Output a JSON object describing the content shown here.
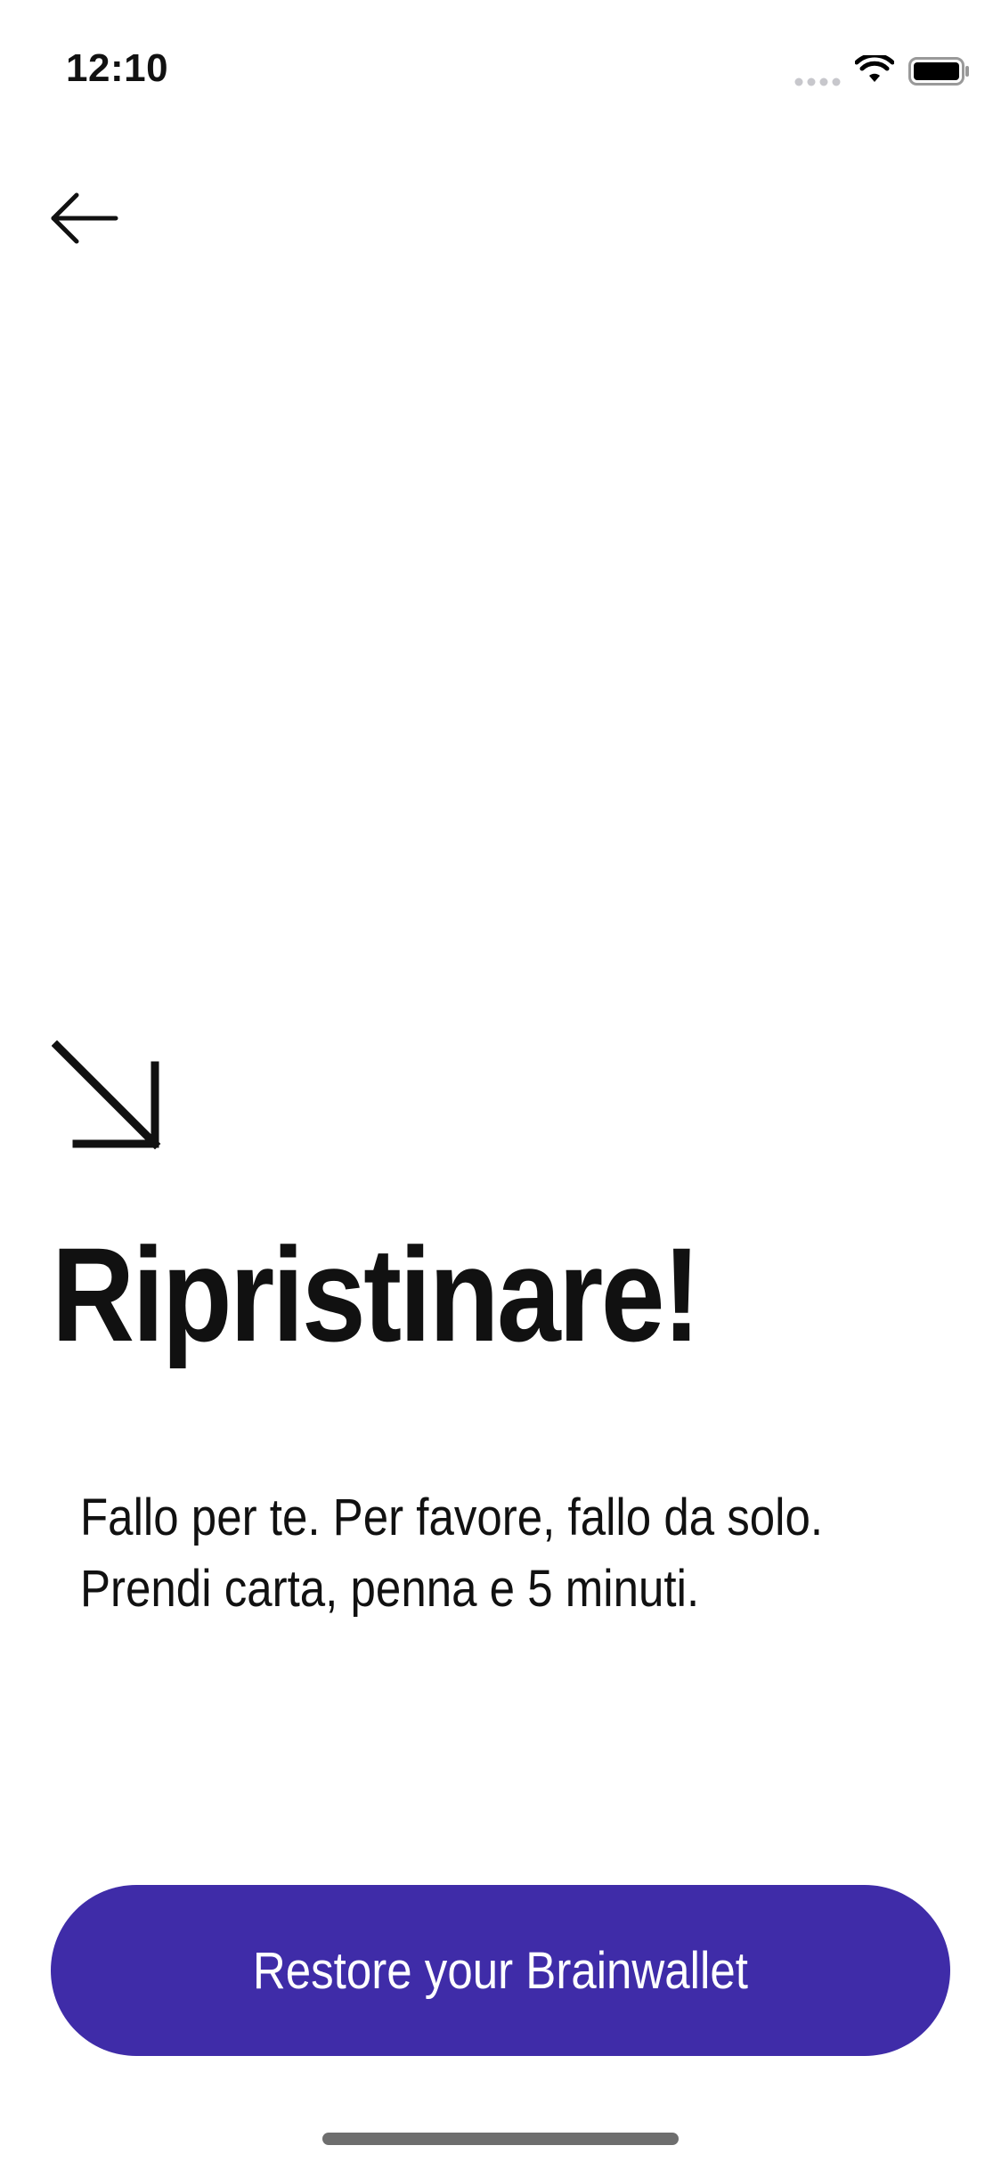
{
  "status_bar": {
    "time": "12:10"
  },
  "navigation": {
    "back_icon": "arrow-left-icon"
  },
  "hero": {
    "icon": "arrow-down-right-icon",
    "title": "Ripristinare!",
    "body_lines": [
      "Fallo per te. Per favore, fallo da solo.",
      "Prendi carta, penna e 5 minuti."
    ]
  },
  "actions": {
    "primary_label": "Restore your Brainwallet"
  },
  "colors": {
    "accent": "#3f2ca8",
    "text": "#111111",
    "background": "#ffffff"
  }
}
